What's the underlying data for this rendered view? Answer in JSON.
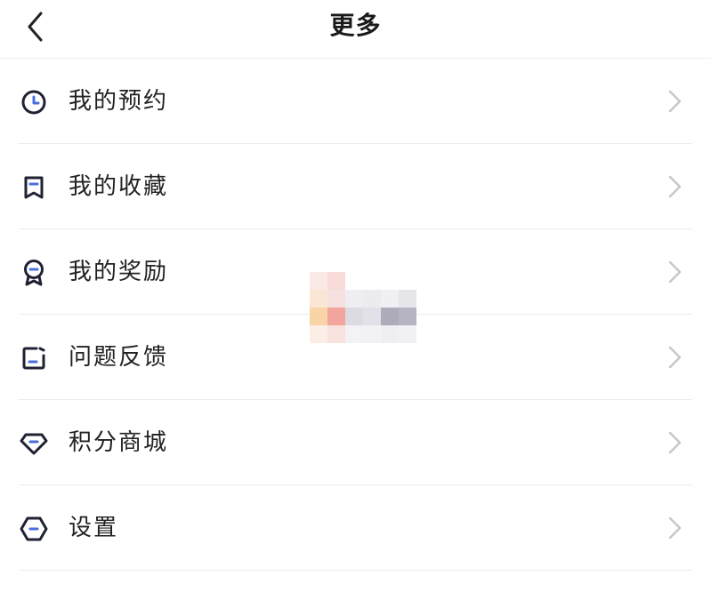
{
  "header": {
    "title": "更多",
    "back_icon": "chevron-left-icon"
  },
  "menu": {
    "items": [
      {
        "label": "我的预约",
        "icon": "clock-icon"
      },
      {
        "label": "我的收藏",
        "icon": "bookmark-icon"
      },
      {
        "label": "我的奖励",
        "icon": "medal-icon"
      },
      {
        "label": "问题反馈",
        "icon": "feedback-icon"
      },
      {
        "label": "积分商城",
        "icon": "diamond-icon"
      },
      {
        "label": "设置",
        "icon": "settings-icon"
      }
    ]
  },
  "colors": {
    "icon_stroke": "#1f2233",
    "icon_accent": "#4a6fdc",
    "chevron": "#c8c8cc",
    "divider": "#ececec"
  }
}
